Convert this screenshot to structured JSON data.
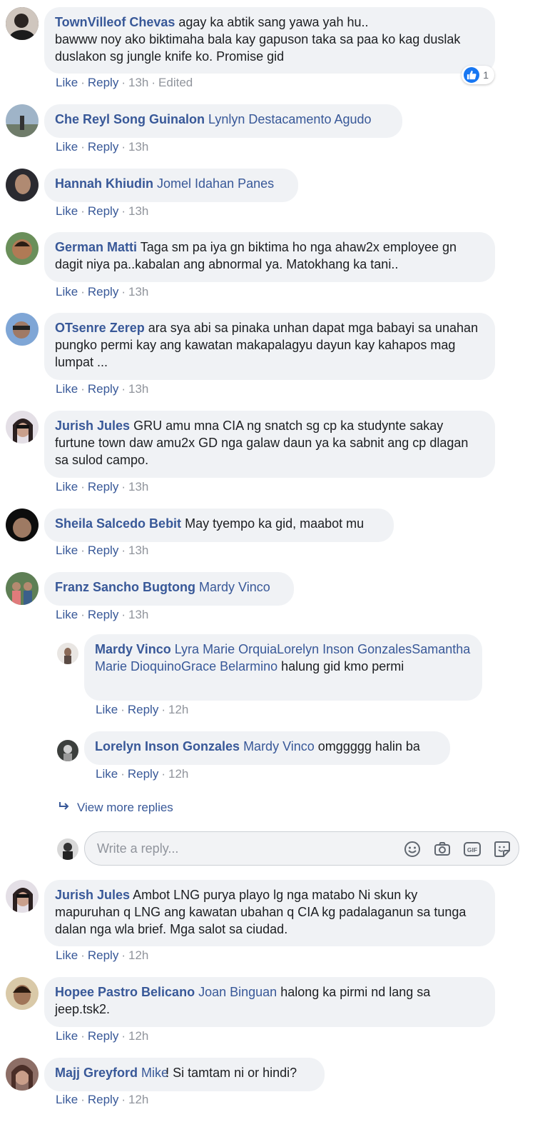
{
  "labels": {
    "like": "Like",
    "reply": "Reply",
    "dot": "·"
  },
  "comments": [
    {
      "name": "TownVilleof Chevas",
      "tag": "",
      "text": "agay ka abtik sang yawa yah hu..\nbawww noy ako biktimaha bala kay gapuson taka sa paa ko kag duslak duslakon sg jungle knife ko. Promise gid",
      "time": "13h",
      "edited": "Edited",
      "reaction_count": "1"
    },
    {
      "name": "Che Reyl Song Guinalon",
      "tag": "Lynlyn Destacamento Agudo",
      "text": "",
      "time": "13h"
    },
    {
      "name": "Hannah Khiudin",
      "tag": "Jomel Idahan Panes",
      "text": "",
      "time": "13h"
    },
    {
      "name": "German Matti",
      "tag": "",
      "text": "Taga sm pa iya gn biktima ho nga ahaw2x employee gn dagit niya pa..kabalan ang abnormal ya. Matokhang ka tani..",
      "time": "13h"
    },
    {
      "name": "OTsenre Zerep",
      "tag": "",
      "text": "ara sya abi sa pinaka unhan dapat mga babayi sa unahan pungko permi kay ang kawatan makapalagyu dayun kay kahapos mag lumpat ...",
      "time": "13h"
    },
    {
      "name": "Jurish Jules",
      "tag": "",
      "text": "GRU amu mna CIA ng snatch sg cp ka studynte sakay furtune town daw amu2x GD nga galaw daun ya ka sabnit ang cp dlagan sa sulod campo.",
      "time": "13h"
    },
    {
      "name": "Sheila Salcedo Bebit",
      "tag": "",
      "text": "May tyempo ka gid, maabot mu",
      "time": "13h"
    },
    {
      "name": "Franz Sancho Bugtong",
      "tag": "Mardy Vinco",
      "text": "",
      "time": "13h"
    },
    {
      "name": "Jurish Jules",
      "tag": "",
      "text": "Ambot LNG purya playo lg nga matabo Ni skun ky mapuruhan q LNG ang kawatan ubahan q CIA kg padalaganun sa tunga dalan nga wla brief. Mga salot sa ciudad.",
      "time": "12h"
    },
    {
      "name": "Hopee Pastro Belicano",
      "tag": "Joan Binguan",
      "text": "halong ka pirmi nd lang sa jeep.tsk2.",
      "time": "12h"
    },
    {
      "name": "Majj Greyford",
      "tag": "Mike",
      "text": "! Si tamtam ni or hindi?",
      "time": "12h"
    }
  ],
  "replies": [
    {
      "name": "Mardy Vinco",
      "tag": "Lyra Marie OrquiaLorelyn Inson GonzalesSamantha Marie DioquinoGrace Belarmino",
      "text": "halung gid kmo permi",
      "time": "12h"
    },
    {
      "name": "Lorelyn Inson Gonzales",
      "tag": "Mardy Vinco",
      "text": "omggggg halin ba",
      "time": "12h"
    }
  ],
  "view_more": "View more replies",
  "composer": {
    "placeholder": "Write a reply..."
  },
  "icons": [
    "like-icon",
    "reply-arrow-icon",
    "emoji-icon",
    "camera-icon",
    "gif-icon",
    "sticker-icon"
  ],
  "colors": {
    "link": "#385898",
    "bubble": "#f0f2f5",
    "meta": "#90949c",
    "like_blue": "#1877f2"
  }
}
